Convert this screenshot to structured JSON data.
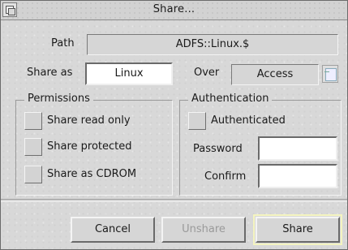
{
  "window": {
    "title": "Share..."
  },
  "path": {
    "label": "Path",
    "value": "ADFS::Linux.$"
  },
  "share_as": {
    "label": "Share as",
    "value": "Linux"
  },
  "over": {
    "label": "Over",
    "value": "Access"
  },
  "permissions": {
    "title": "Permissions",
    "options": [
      {
        "label": "Share read only"
      },
      {
        "label": "Share protected"
      },
      {
        "label": "Share as CDROM"
      }
    ]
  },
  "authentication": {
    "title": "Authentication",
    "authenticated_label": "Authenticated",
    "password_label": "Password",
    "password_value": "",
    "confirm_label": "Confirm",
    "confirm_value": ""
  },
  "buttons": {
    "cancel": "Cancel",
    "unshare": "Unshare",
    "share": "Share"
  }
}
